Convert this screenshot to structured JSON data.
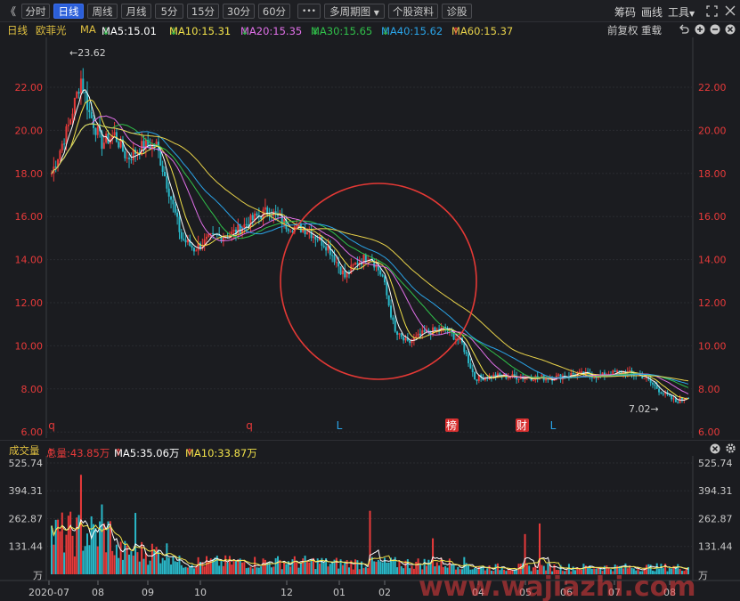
{
  "toolbar": {
    "back": "《",
    "periods": [
      "分时",
      "日线",
      "周线",
      "月线",
      "5分",
      "15分",
      "30分",
      "60分"
    ],
    "active_period": "日线",
    "more": "•••",
    "multi_period": "多周期图",
    "profile": "个股资料",
    "diagnose": "诊股",
    "chips": "筹码",
    "draw": "画线",
    "tools": "工具"
  },
  "info": {
    "period": "日线",
    "name": "欧菲光",
    "indicator": "MA",
    "ma": [
      {
        "label": "MA5:15.01",
        "arrow": "↓",
        "color": "#ffffff"
      },
      {
        "label": "MA10:15.31",
        "arrow": "↓",
        "color": "#f2e24a"
      },
      {
        "label": "MA20:15.35",
        "arrow": "↓",
        "color": "#e070e8"
      },
      {
        "label": "MA30:15.65",
        "arrow": "↓",
        "color": "#30c04a"
      },
      {
        "label": "MA40:15.62",
        "arrow": "↓",
        "color": "#2aa4e8"
      },
      {
        "label": "MA60:15.37",
        "arrow": "↑",
        "color": "#e8d24a"
      }
    ],
    "adjust": "前复权",
    "reload": "重载"
  },
  "price_axis": {
    "ticks": [
      "22.00",
      "20.00",
      "18.00",
      "16.00",
      "14.00",
      "12.00",
      "10.00",
      "8.00",
      "6.00"
    ]
  },
  "annotations": {
    "high": "←23.62",
    "low": "7.02→"
  },
  "markers": [
    {
      "text": "q",
      "color": "#e83a3a",
      "box": false
    },
    {
      "text": "q",
      "color": "#e83a3a",
      "box": false
    },
    {
      "text": "L",
      "color": "#2aa4e8",
      "box": false
    },
    {
      "text": "榜",
      "color": "#ffffff",
      "box": true
    },
    {
      "text": "财",
      "color": "#ffffff",
      "box": true
    },
    {
      "text": "L",
      "color": "#2aa4e8",
      "box": false
    }
  ],
  "volume": {
    "title": "成交量",
    "total": "总量:43.85万",
    "total_arrow": "↑",
    "ma5": "MA5:35.06万",
    "ma5_arrow": "↑",
    "ma10": "MA10:33.87万",
    "ma10_arrow": "↑",
    "ticks": [
      "525.74",
      "394.31",
      "262.87",
      "131.44",
      "万"
    ]
  },
  "x_axis": [
    "2020-07",
    "08",
    "09",
    "10",
    "12",
    "01",
    "02",
    "04",
    "05",
    "06",
    "07",
    "08"
  ],
  "watermark": "www.wajiazhi.com",
  "colors": {
    "up": "#e83a3a",
    "down": "#29b8c8",
    "axis": "#e83a3a",
    "circle": "#e53935"
  }
}
